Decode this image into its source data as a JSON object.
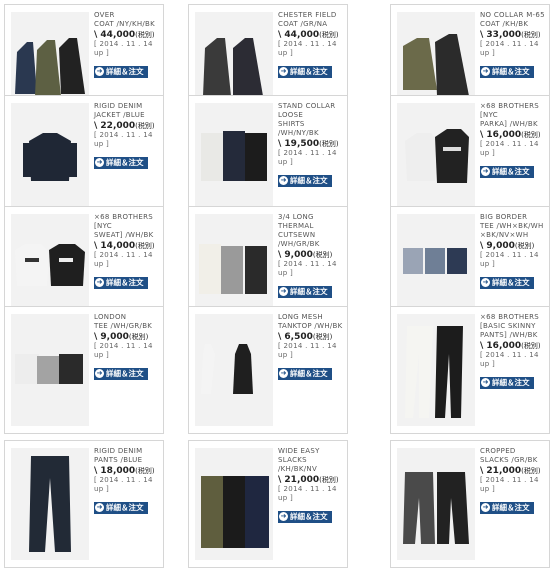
{
  "products": [
    {
      "name": "OVER\nCOAT /NY/KH/BK",
      "price": "\\ 44,000",
      "tax": "(税別)",
      "date": "[ 2014 . 11 . 14 up ]",
      "button": "詳細＆注文",
      "icon": "arrow-right-icon"
    },
    {
      "name": "CHESTER FIELD\nCOAT /GR/NA",
      "price": "\\ 44,000",
      "tax": "(税別)",
      "date": "[ 2014 . 11 . 14 up ]",
      "button": "詳細＆注文",
      "icon": "arrow-right-icon"
    },
    {
      "name": "NO COLLAR M-65\nCOAT /KH/BK",
      "price": "\\ 33,000",
      "tax": "(税別)",
      "date": "[ 2014 . 11 . 14 up ]",
      "button": "詳細＆注文",
      "icon": "arrow-right-icon"
    },
    {
      "name": "RIGID DENIM\nJACKET /BLUE",
      "price": "\\ 22,000",
      "tax": "(税別)",
      "date": "[ 2014 . 11 . 14 up ]",
      "button": "詳細＆注文",
      "icon": "arrow-right-icon"
    },
    {
      "name": "STAND COLLAR\nLOOSE\nSHIRTS /WH/NY/BK",
      "price": "\\ 19,500",
      "tax": "(税別)",
      "date": "[ 2014 . 11 . 14 up ]",
      "button": "詳細＆注文",
      "icon": "arrow-right-icon"
    },
    {
      "name": "×68 BROTHERS\n[NYC\nPARKA] /WH/BK",
      "price": "\\ 16,000",
      "tax": "(税別)",
      "date": "[ 2014 . 11 . 14 up ]",
      "button": "詳細＆注文",
      "icon": "arrow-right-icon"
    },
    {
      "name": "×68 BROTHERS\n[NYC\nSWEAT] /WH/BK",
      "price": "\\ 14,000",
      "tax": "(税別)",
      "date": "[ 2014 . 11 . 14 up ]",
      "button": "詳細＆注文",
      "icon": "arrow-right-icon"
    },
    {
      "name": "3/4 LONG THERMAL\nCUTSEWN /WH/GR/BK",
      "price": "\\ 9,000",
      "tax": "(税別)",
      "date": "[ 2014 . 11 . 14 up ]",
      "button": "詳細＆注文",
      "icon": "arrow-right-icon"
    },
    {
      "name": "BIG BORDER\nTEE /WH×BK/WH\n×BK/NV×WH",
      "price": "\\ 9,000",
      "tax": "(税別)",
      "date": "[ 2014 . 11 . 14 up ]",
      "button": "詳細＆注文",
      "icon": "arrow-right-icon"
    },
    {
      "name": "LONDON\nTEE /WH/GR/BK",
      "price": "\\ 9,000",
      "tax": "(税別)",
      "date": "[ 2014 . 11 . 14 up ]",
      "button": "詳細＆注文",
      "icon": "arrow-right-icon"
    },
    {
      "name": "LONG MESH\nTANKTOP /WH/BK",
      "price": "\\ 6,500",
      "tax": "(税別)",
      "date": "[ 2014 . 11 . 14 up ]",
      "button": "詳細＆注文",
      "icon": "arrow-right-icon"
    },
    {
      "name": "×68 BROTHERS\n[BASIC SKINNY\nPANTS] /WH/BK",
      "price": "\\ 16,000",
      "tax": "(税別)",
      "date": "[ 2014 . 11 . 14 up ]",
      "button": "詳細＆注文",
      "icon": "arrow-right-icon"
    },
    {
      "name": "RIGID DENIM\nPANTS /BLUE",
      "price": "\\ 18,000",
      "tax": "(税別)",
      "date": "[ 2014 . 11 . 14 up ]",
      "button": "詳細＆注文",
      "icon": "arrow-right-icon"
    },
    {
      "name": "WIDE EASY\nSLACKS /KH/BK/NV",
      "price": "\\ 21,000",
      "tax": "(税別)",
      "date": "[ 2014 . 11 . 14 up ]",
      "button": "詳細＆注文",
      "icon": "arrow-right-icon"
    },
    {
      "name": "CROPPED\nSLACKS /GR/BK",
      "price": "\\ 21,000",
      "tax": "(税別)",
      "date": "[ 2014 . 11 . 14 up ]",
      "button": "詳細＆注文",
      "icon": "arrow-right-icon"
    }
  ],
  "colors": {
    "button_bg": "#1f4f86",
    "card_border": "#d6d6d6"
  }
}
